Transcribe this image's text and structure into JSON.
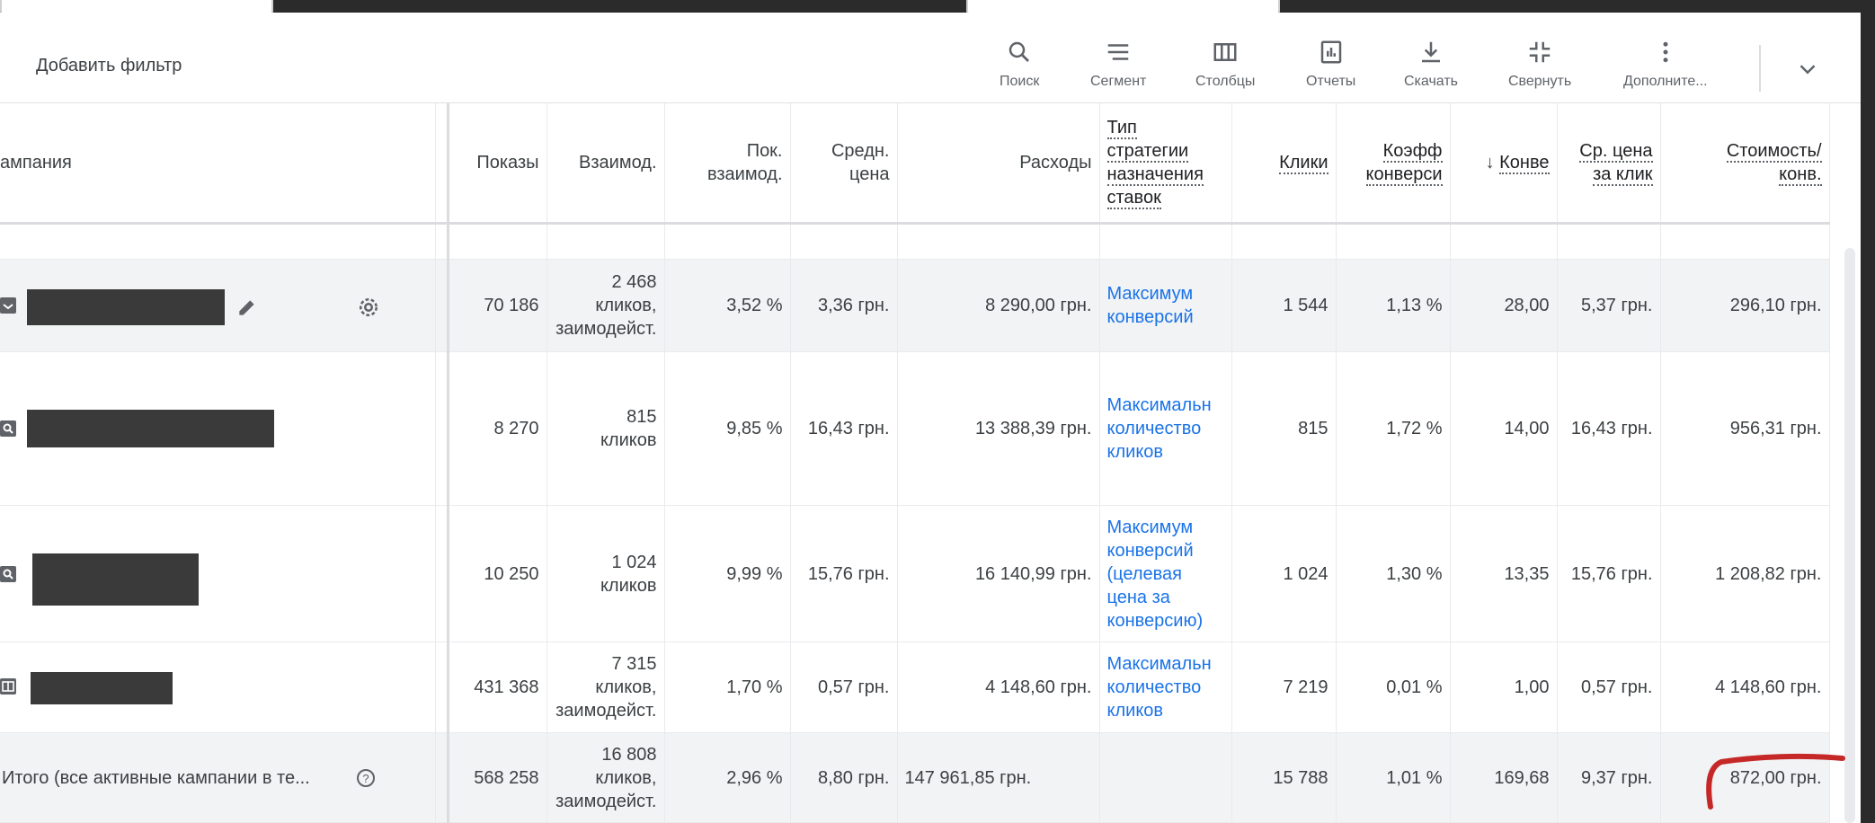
{
  "toolbar": {
    "add_filter": "Добавить фильтр",
    "tools": [
      {
        "label": "Поиск",
        "icon": "search-icon"
      },
      {
        "label": "Сегмент",
        "icon": "segment-icon"
      },
      {
        "label": "Столбцы",
        "icon": "columns-icon"
      },
      {
        "label": "Отчеты",
        "icon": "reports-icon"
      },
      {
        "label": "Скачать",
        "icon": "download-icon"
      },
      {
        "label": "Свернуть",
        "icon": "collapse-icon"
      },
      {
        "label": "Дополните...",
        "icon": "more-vert-icon"
      }
    ]
  },
  "columns": {
    "campaign": "ампания",
    "impressions": "Показы",
    "interactions": "Взаимод.",
    "interaction_rate": [
      "Пок.",
      "взаимод."
    ],
    "avg_cost": [
      "Средн.",
      "цена"
    ],
    "cost": "Расходы",
    "bid_strategy": [
      "Тип",
      "стратегии",
      "назначения",
      "ставок"
    ],
    "clicks": "Клики",
    "conv_rate": [
      "Коэфф",
      "конверси"
    ],
    "conversions": "Конве",
    "sort_arrow": "↓",
    "avg_cpc": [
      "Ср. цена",
      "за клик"
    ],
    "cost_per_conv": [
      "Стоимость/",
      "конв."
    ]
  },
  "rows": [
    {
      "impressions": "70 186",
      "interactions": [
        "2 468",
        "кликов,",
        "заимодейст."
      ],
      "interaction_rate": "3,52 %",
      "avg_cost": "3,36 грн.",
      "cost": "8 290,00 грн.",
      "bid_strategy": [
        "Максимум",
        "конверсий"
      ],
      "clicks": "1 544",
      "conv_rate": "1,13 %",
      "conversions": "28,00",
      "avg_cpc": "5,37 грн.",
      "cost_per_conv": "296,10 грн."
    },
    {
      "impressions": "8 270",
      "interactions": [
        "815",
        "кликов"
      ],
      "interaction_rate": "9,85 %",
      "avg_cost": "16,43 грн.",
      "cost": "13 388,39 грн.",
      "bid_strategy": [
        "Максимальн",
        "количество",
        "кликов"
      ],
      "clicks": "815",
      "conv_rate": "1,72 %",
      "conversions": "14,00",
      "avg_cpc": "16,43 грн.",
      "cost_per_conv": "956,31 грн."
    },
    {
      "impressions": "10 250",
      "interactions": [
        "1 024",
        "кликов"
      ],
      "interaction_rate": "9,99 %",
      "avg_cost": "15,76 грн.",
      "cost": "16 140,99 грн.",
      "bid_strategy": [
        "Максимум",
        "конверсий",
        "(целевая",
        "цена за",
        "конверсию)"
      ],
      "clicks": "1 024",
      "conv_rate": "1,30 %",
      "conversions": "13,35",
      "avg_cpc": "15,76 грн.",
      "cost_per_conv": "1 208,82 грн."
    },
    {
      "impressions": "431 368",
      "interactions": [
        "7 315",
        "кликов,",
        "заимодейст."
      ],
      "interaction_rate": "1,70 %",
      "avg_cost": "0,57 грн.",
      "cost": "4 148,60 грн.",
      "bid_strategy": [
        "Максимальн",
        "количество",
        "кликов"
      ],
      "clicks": "7 219",
      "conv_rate": "0,01 %",
      "conversions": "1,00",
      "avg_cpc": "0,57 грн.",
      "cost_per_conv": "4 148,60 грн."
    }
  ],
  "total": {
    "label": "Итого (все активные кампании в те...",
    "impressions": "568 258",
    "interactions": [
      "16 808",
      "кликов,",
      "заимодейст."
    ],
    "interaction_rate": "2,96 %",
    "avg_cost": "8,80 грн.",
    "cost": "147 961,85 грн.",
    "clicks": "15 788",
    "conv_rate": "1,01 %",
    "conversions": "169,68",
    "avg_cpc": "9,37 грн.",
    "cost_per_conv": "872,00 грн."
  },
  "colors": {
    "link": "#1a73e8",
    "highlight_mark": "#c62828"
  }
}
